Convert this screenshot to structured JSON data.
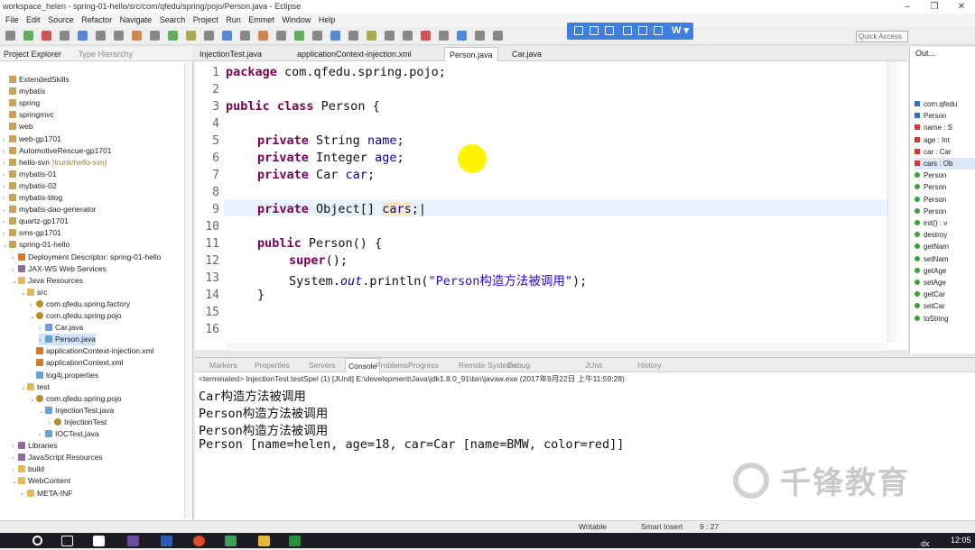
{
  "window": {
    "title": "workspace_helen - spring-01-hello/src/com/qfedu/spring/pojo/Person.java - Eclipse"
  },
  "menu": [
    "File",
    "Edit",
    "Source",
    "Refactor",
    "Navigate",
    "Search",
    "Project",
    "Run",
    "Emmet",
    "Window",
    "Help"
  ],
  "quick_access": "Quick Access",
  "left_tabs": [
    "Project Explorer",
    "Type Hierarchy"
  ],
  "tree": [
    {
      "label": "ExtendedSkills",
      "depth": 0,
      "icon": "proj",
      "tw": ""
    },
    {
      "label": "mybatis",
      "depth": 0,
      "icon": "proj",
      "tw": ""
    },
    {
      "label": "spring",
      "depth": 0,
      "icon": "proj",
      "tw": ""
    },
    {
      "label": "springmvc",
      "depth": 0,
      "icon": "proj",
      "tw": ""
    },
    {
      "label": "web",
      "depth": 0,
      "icon": "proj",
      "tw": ""
    },
    {
      "label": "web-gp1701",
      "depth": 0,
      "icon": "proj",
      "tw": "›"
    },
    {
      "label": "AutomotiveRescue-gp1701",
      "depth": 0,
      "icon": "proj",
      "tw": "›"
    },
    {
      "label": "hello-svn",
      "depth": 0,
      "icon": "proj",
      "tw": "›",
      "extra": "[trunk/hello-svn]"
    },
    {
      "label": "mybatis-01",
      "depth": 0,
      "icon": "proj",
      "tw": "›"
    },
    {
      "label": "mybatis-02",
      "depth": 0,
      "icon": "proj",
      "tw": "›"
    },
    {
      "label": "mybatis-blog",
      "depth": 0,
      "icon": "proj",
      "tw": "›"
    },
    {
      "label": "mybatis-dao-generator",
      "depth": 0,
      "icon": "proj",
      "tw": "›"
    },
    {
      "label": "quartz-gp1701",
      "depth": 0,
      "icon": "proj",
      "tw": "›"
    },
    {
      "label": "sms-gp1701",
      "depth": 0,
      "icon": "proj",
      "tw": "›"
    },
    {
      "label": "spring-01-hello",
      "depth": 0,
      "icon": "proj",
      "tw": "⌄"
    },
    {
      "label": "Deployment Descriptor: spring-01-hello",
      "depth": 1,
      "icon": "xfile",
      "tw": "›"
    },
    {
      "label": "JAX-WS Web Services",
      "depth": 1,
      "icon": "libs",
      "tw": "›"
    },
    {
      "label": "Java Resources",
      "depth": 1,
      "icon": "fold",
      "tw": "⌄"
    },
    {
      "label": "src",
      "depth": 2,
      "icon": "fold",
      "tw": "⌄"
    },
    {
      "label": "com.qfedu.spring.factory",
      "depth": 3,
      "icon": "pkg",
      "tw": "›"
    },
    {
      "label": "com.qfedu.spring.pojo",
      "depth": 3,
      "icon": "pkg",
      "tw": "⌄"
    },
    {
      "label": "Car.java",
      "depth": 4,
      "icon": "jfile",
      "tw": "›"
    },
    {
      "label": "Person.java",
      "depth": 4,
      "icon": "jfile",
      "tw": "›",
      "selected": true
    },
    {
      "label": "applicationContext-injection.xml",
      "depth": 3,
      "icon": "xfile",
      "tw": ""
    },
    {
      "label": "applicationContext.xml",
      "depth": 3,
      "icon": "xfile",
      "tw": ""
    },
    {
      "label": "log4j.properties",
      "depth": 3,
      "icon": "jfile",
      "tw": ""
    },
    {
      "label": "test",
      "depth": 2,
      "icon": "fold",
      "tw": "⌄"
    },
    {
      "label": "com.qfedu.spring.pojo",
      "depth": 3,
      "icon": "pkg",
      "tw": "⌄"
    },
    {
      "label": "InjectionTest.java",
      "depth": 4,
      "icon": "jfile",
      "tw": "⌄"
    },
    {
      "label": "InjectionTest",
      "depth": 5,
      "icon": "pkg",
      "tw": "›"
    },
    {
      "label": "IOCTest.java",
      "depth": 4,
      "icon": "jfile",
      "tw": "›"
    },
    {
      "label": "Libraries",
      "depth": 1,
      "icon": "libs",
      "tw": "›"
    },
    {
      "label": "JavaScript Resources",
      "depth": 1,
      "icon": "libs",
      "tw": "›"
    },
    {
      "label": "build",
      "depth": 1,
      "icon": "fold",
      "tw": "›"
    },
    {
      "label": "WebContent",
      "depth": 1,
      "icon": "fold",
      "tw": "⌄"
    },
    {
      "label": "META-INF",
      "depth": 2,
      "icon": "fold",
      "tw": "›"
    }
  ],
  "editor_tabs": [
    "InjectionTest.java",
    "applicationContext-injection.xml",
    "Person.java",
    "Car.java"
  ],
  "line_numbers": [
    "1",
    "2",
    "3",
    "4",
    "5",
    "6",
    "7",
    "8",
    "9",
    "10",
    "11",
    "12",
    "13",
    "14",
    "15",
    "16"
  ],
  "code": {
    "l1_kw": "package",
    "l1_rest": " com.qfedu.spring.pojo;",
    "l3_kw": "public class",
    "l3_rest": " Person {",
    "l5_kw": "private",
    "l5_type": " String ",
    "l5_fld": "name",
    "l5_end": ";",
    "l6_kw": "private",
    "l6_type": " Integer ",
    "l6_fld": "age",
    "l6_end": ";",
    "l7_kw": "private",
    "l7_type": " Car ",
    "l7_fld": "car",
    "l7_end": ";",
    "l9_kw": "private",
    "l9_type": " Object[] ",
    "l9_fld": "cars",
    "l9_end": ";",
    "l11_kw": "public",
    "l11_rest": " Person() {",
    "l12_kw": "super",
    "l12_rest": "();",
    "l13_pre": "System.",
    "l13_out": "out",
    "l13_mid": ".println(",
    "l13_str": "\"Person构造方法被调用\"",
    "l13_end": ");",
    "l14": "}"
  },
  "outline_tabs": [
    "Out..."
  ],
  "outline": [
    {
      "label": "com.qfedu",
      "kind": "pkg"
    },
    {
      "label": "Person",
      "kind": "cls"
    },
    {
      "label": "name : S",
      "kind": "fld"
    },
    {
      "label": "age : Int",
      "kind": "fld"
    },
    {
      "label": "car : Car",
      "kind": "fld"
    },
    {
      "label": "cars : Ob",
      "kind": "fld"
    },
    {
      "label": "Person",
      "kind": "ctor"
    },
    {
      "label": "Person",
      "kind": "ctor"
    },
    {
      "label": "Person",
      "kind": "ctor"
    },
    {
      "label": "Person",
      "kind": "ctor"
    },
    {
      "label": "init() : v",
      "kind": "mth"
    },
    {
      "label": "destroy",
      "kind": "mth"
    },
    {
      "label": "getNam",
      "kind": "mth"
    },
    {
      "label": "setNam",
      "kind": "mth"
    },
    {
      "label": "getAge",
      "kind": "mth"
    },
    {
      "label": "setAge",
      "kind": "mth"
    },
    {
      "label": "getCar",
      "kind": "mth"
    },
    {
      "label": "setCar",
      "kind": "mth"
    },
    {
      "label": "toString",
      "kind": "mth"
    }
  ],
  "console_tabs": [
    "Markers",
    "Properties",
    "Servers",
    "Console",
    "Problems",
    "Progress",
    "Remote Systems",
    "Debug",
    "JUnit",
    "History"
  ],
  "console_header": "<terminated> InjectionTest.testSpel (1) [JUnit] E:\\development\\Java\\jdk1.8.0_91\\bin\\javaw.exe (2017年9月22日 上午11:59:28)",
  "console_lines": [
    "Car构造方法被调用",
    "Person构造方法被调用",
    "Person构造方法被调用",
    "Person [name=helen, age=18, car=Car [name=BMW, color=red]]"
  ],
  "status": {
    "writable": "Writable",
    "insert": "Smart Insert",
    "pos": "9 : 27"
  },
  "watermark": "千锋教育",
  "taskbar": {
    "time": "12:05",
    "lang": "dx"
  },
  "colors": {
    "keyword": "#7f0055",
    "field": "#0000c0",
    "string": "#2a00ff",
    "accent_toolbar": "#3f7fe0"
  }
}
